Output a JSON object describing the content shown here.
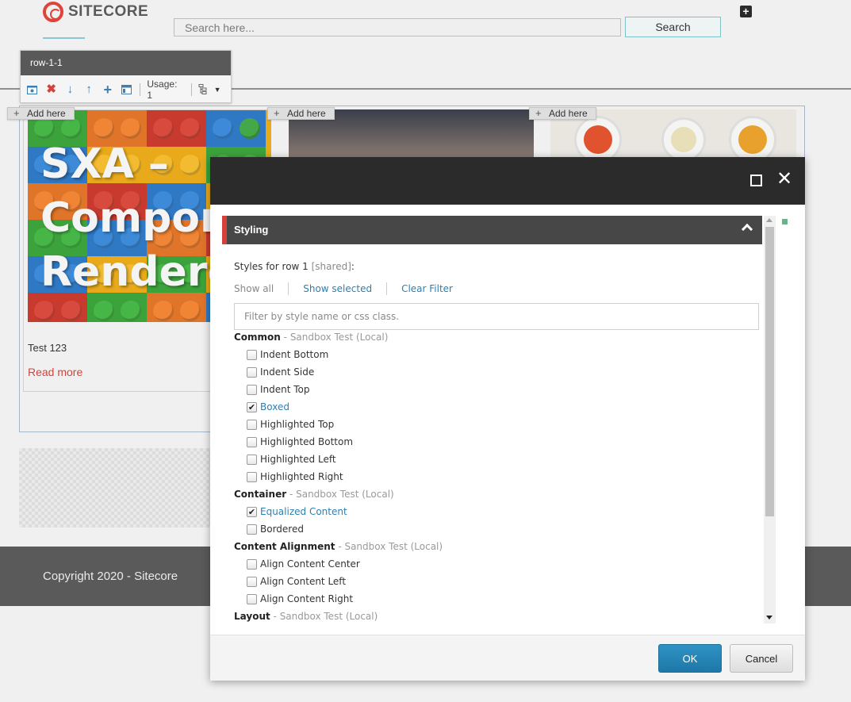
{
  "header": {
    "logo_text": "SITECORE",
    "search_placeholder": "Search here...",
    "search_button": "Search",
    "add_icon": "plus-square-icon"
  },
  "row_toolbar": {
    "title": "row-1-1",
    "usage_label": "Usage: 1",
    "icons": [
      "properties-icon",
      "delete-icon",
      "move-down-icon",
      "move-up-icon",
      "add-icon",
      "layout-icon",
      "tree-icon",
      "dropdown-icon"
    ]
  },
  "add_here_label": "Add here",
  "card1": {
    "image_text": [
      "SXA –",
      "Compone",
      "Renderer"
    ],
    "text": "Test 123",
    "link": "Read more"
  },
  "footer": {
    "copyright": "Copyright 2020 - Sitecore"
  },
  "dialog": {
    "section_title": "Styling",
    "styles_for": "Styles for row 1",
    "styles_shared": "[shared]",
    "styles_suffix": ":",
    "filter_links": [
      "Show all",
      "Show selected",
      "Clear Filter"
    ],
    "filter_placeholder": "Filter by style name or css class.",
    "groups": [
      {
        "name": "Common",
        "source": " - Sandbox Test (Local)",
        "items": [
          {
            "label": "Indent Bottom",
            "checked": false
          },
          {
            "label": "Indent Side",
            "checked": false
          },
          {
            "label": "Indent Top",
            "checked": false
          },
          {
            "label": "Boxed",
            "checked": true
          },
          {
            "label": "Highlighted Top",
            "checked": false
          },
          {
            "label": "Highlighted Bottom",
            "checked": false
          },
          {
            "label": "Highlighted Left",
            "checked": false
          },
          {
            "label": "Highlighted Right",
            "checked": false
          }
        ]
      },
      {
        "name": "Container",
        "source": " - Sandbox Test (Local)",
        "items": [
          {
            "label": "Equalized Content",
            "checked": true
          },
          {
            "label": "Bordered",
            "checked": false
          }
        ]
      },
      {
        "name": "Content Alignment",
        "source": " - Sandbox Test (Local)",
        "items": [
          {
            "label": "Align Content Center",
            "checked": false
          },
          {
            "label": "Align Content Left",
            "checked": false
          },
          {
            "label": "Align Content Right",
            "checked": false
          }
        ]
      },
      {
        "name": "Layout",
        "source": " - Sandbox Test (Local)",
        "items": []
      }
    ],
    "ok_label": "OK",
    "cancel_label": "Cancel"
  },
  "colors": {
    "accent_red": "#d3413a",
    "link_blue": "#2e7faf",
    "ok_blue": "#1e78a8",
    "titlebar": "#2b2b2b"
  }
}
